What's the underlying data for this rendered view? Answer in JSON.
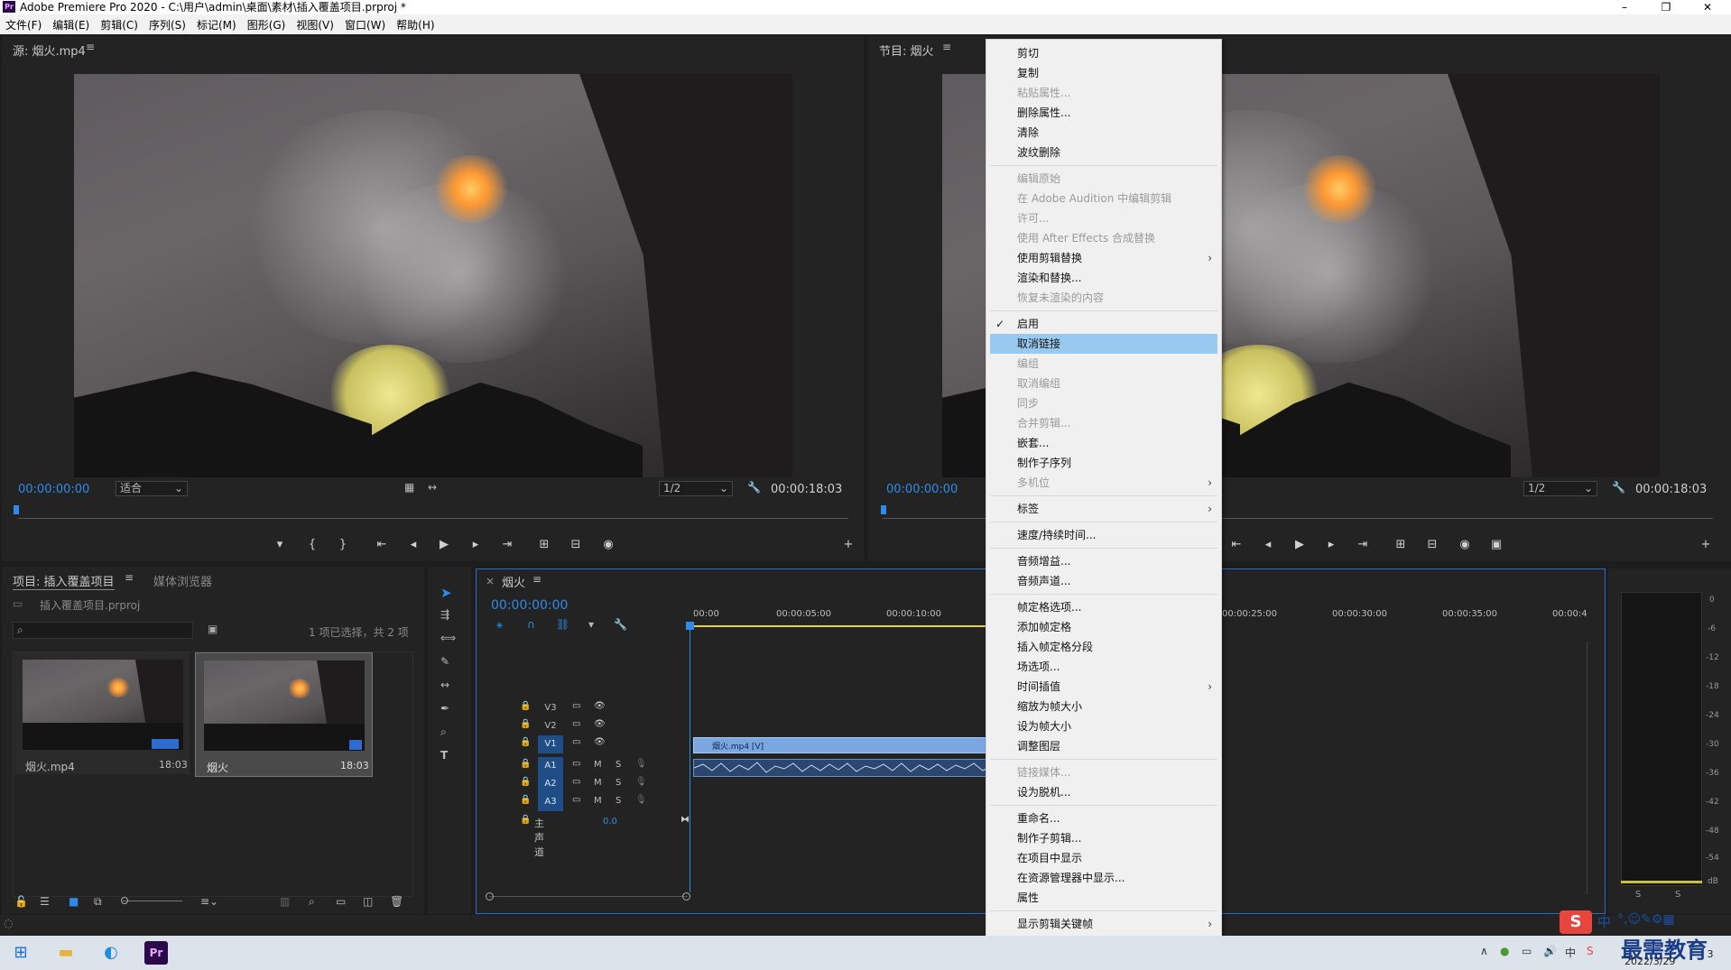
{
  "window": {
    "title": "Adobe Premiere Pro 2020 - C:\\用户\\admin\\桌面\\素材\\插入覆盖项目.prproj *",
    "minimize": "–",
    "maximize": "❐",
    "close": "✕"
  },
  "menubar": [
    "文件(F)",
    "编辑(E)",
    "剪辑(C)",
    "序列(S)",
    "标记(M)",
    "图形(G)",
    "视图(V)",
    "窗口(W)",
    "帮助(H)"
  ],
  "source_monitor": {
    "title": "源: 烟火.mp4",
    "timecode": "00:00:00:00",
    "zoom": "适合",
    "resolution": "1/2",
    "duration": "00:00:18:03"
  },
  "program_monitor": {
    "title": "节目: 烟火",
    "timecode": "00:00:00:00",
    "resolution": "1/2",
    "duration": "00:00:18:03"
  },
  "project_panel": {
    "tab_project": "项目: 插入覆盖项目",
    "tab_media": "媒体浏览器",
    "project_file": "插入覆盖项目.prproj",
    "selection_info": "1 项已选择，共 2 项",
    "items": [
      {
        "name": "烟火.mp4",
        "duration": "18:03"
      },
      {
        "name": "烟火",
        "duration": "18:03"
      }
    ]
  },
  "timeline": {
    "tab": "烟火",
    "timecode": "00:00:00:00",
    "ruler": [
      "00:00",
      "00:00:05:00",
      "00:00:10:00",
      "00:00:25:00",
      "00:00:30:00",
      "00:00:35:00",
      "00:00:4"
    ],
    "video_tracks": [
      "V3",
      "V2",
      "V1"
    ],
    "audio_tracks": [
      "A1",
      "A2",
      "A3"
    ],
    "master_label": "主声道",
    "master_value": "0.0",
    "clip_label": "烟火.mp4 [V]",
    "mute": "M",
    "solo": "S"
  },
  "audio_meter": {
    "scale": [
      "0",
      "-6",
      "-12",
      "-18",
      "-24",
      "-30",
      "-36",
      "-42",
      "-48",
      "-54",
      "dB"
    ],
    "solo_left": "S",
    "solo_right": "S"
  },
  "context_menu": {
    "items": [
      {
        "label": "剪切",
        "enabled": true
      },
      {
        "label": "复制",
        "enabled": true
      },
      {
        "label": "粘贴属性...",
        "enabled": false
      },
      {
        "label": "删除属性...",
        "enabled": true
      },
      {
        "label": "清除",
        "enabled": true
      },
      {
        "label": "波纹删除",
        "enabled": true
      },
      {
        "label": "编辑原始",
        "enabled": false
      },
      {
        "label": "在 Adobe Audition 中编辑剪辑",
        "enabled": false
      },
      {
        "label": "许可...",
        "enabled": false
      },
      {
        "label": "使用 After Effects 合成替换",
        "enabled": false
      },
      {
        "label": "使用剪辑替换",
        "enabled": true,
        "submenu": true
      },
      {
        "label": "渲染和替换...",
        "enabled": true
      },
      {
        "label": "恢复未渲染的内容",
        "enabled": false
      },
      {
        "label": "启用",
        "enabled": true,
        "checked": true
      },
      {
        "label": "取消链接",
        "enabled": true,
        "highlighted": true
      },
      {
        "label": "编组",
        "enabled": false
      },
      {
        "label": "取消编组",
        "enabled": false
      },
      {
        "label": "同步",
        "enabled": false
      },
      {
        "label": "合并剪辑...",
        "enabled": false
      },
      {
        "label": "嵌套...",
        "enabled": true
      },
      {
        "label": "制作子序列",
        "enabled": true
      },
      {
        "label": "多机位",
        "enabled": false,
        "submenu": true
      },
      {
        "label": "标签",
        "enabled": true,
        "submenu": true
      },
      {
        "label": "速度/持续时间...",
        "enabled": true
      },
      {
        "label": "音频增益...",
        "enabled": true
      },
      {
        "label": "音频声道...",
        "enabled": true
      },
      {
        "label": "帧定格选项...",
        "enabled": true
      },
      {
        "label": "添加帧定格",
        "enabled": true
      },
      {
        "label": "插入帧定格分段",
        "enabled": true
      },
      {
        "label": "场选项...",
        "enabled": true
      },
      {
        "label": "时间插值",
        "enabled": true,
        "submenu": true
      },
      {
        "label": "缩放为帧大小",
        "enabled": true
      },
      {
        "label": "设为帧大小",
        "enabled": true
      },
      {
        "label": "调整图层",
        "enabled": true
      },
      {
        "label": "链接媒体...",
        "enabled": false
      },
      {
        "label": "设为脱机...",
        "enabled": true
      },
      {
        "label": "重命名...",
        "enabled": true
      },
      {
        "label": "制作子剪辑...",
        "enabled": true
      },
      {
        "label": "在项目中显示",
        "enabled": true
      },
      {
        "label": "在资源管理器中显示...",
        "enabled": true
      },
      {
        "label": "属性",
        "enabled": true
      },
      {
        "label": "显示剪辑关键帧",
        "enabled": true,
        "submenu": true
      }
    ]
  },
  "taskbar": {
    "ime": "中",
    "watermark": "最需教育",
    "date": "2022/3/29",
    "notification_count": "3"
  },
  "colors": {
    "accent_blue": "#2d8ceb",
    "menu_highlight": "#99c9ef",
    "panel_bg": "#232323",
    "track_badge": "#1f4e86"
  }
}
